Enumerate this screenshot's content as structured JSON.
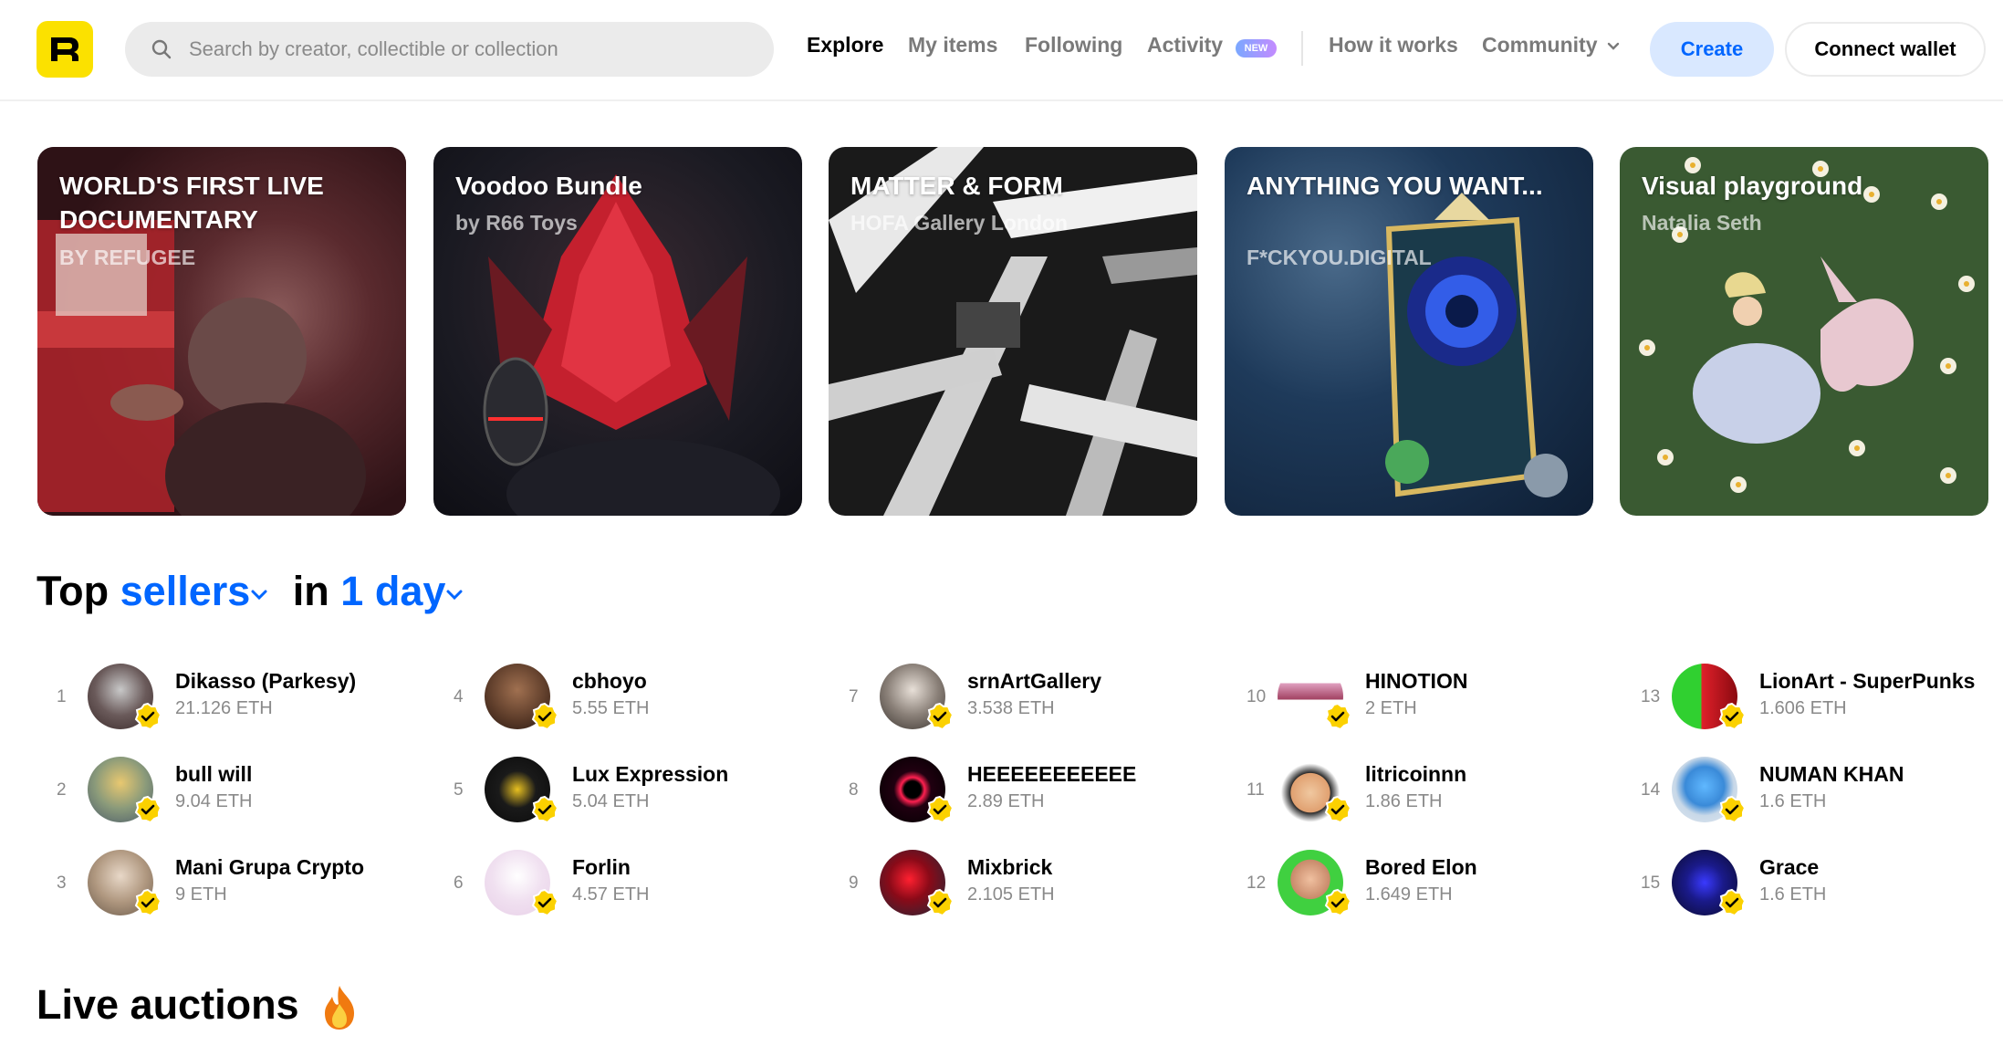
{
  "header": {
    "search_placeholder": "Search by creator, collectible or collection",
    "nav": {
      "explore": "Explore",
      "my_items": "My items",
      "following": "Following",
      "activity": "Activity",
      "activity_badge": "NEW",
      "how_it_works": "How it works",
      "community": "Community"
    },
    "create_label": "Create",
    "connect_label": "Connect wallet"
  },
  "banners": [
    {
      "title": "WORLD'S FIRST LIVE DOCUMENTARY",
      "subtitle": "BY REFUGEE"
    },
    {
      "title": "Voodoo Bundle",
      "subtitle": "by R66 Toys"
    },
    {
      "title": "MATTER & FORM",
      "subtitle": "HOFA Gallery London"
    },
    {
      "title": "ANYTHING YOU WANT...",
      "subtitle": "F*CKYOU.DIGITAL"
    },
    {
      "title": "Visual playground",
      "subtitle": "Natalia Seth"
    }
  ],
  "top_sellers": {
    "prefix": "Top",
    "kind": "sellers",
    "connector": "in",
    "period": "1 day",
    "items": [
      {
        "rank": "1",
        "name": "Dikasso (Parkesy)",
        "eth": "21.126 ETH"
      },
      {
        "rank": "2",
        "name": "bull will",
        "eth": "9.04 ETH"
      },
      {
        "rank": "3",
        "name": "Mani Grupa Crypto",
        "eth": "9 ETH"
      },
      {
        "rank": "4",
        "name": "cbhoyo",
        "eth": "5.55 ETH"
      },
      {
        "rank": "5",
        "name": "Lux Expression",
        "eth": "5.04 ETH"
      },
      {
        "rank": "6",
        "name": "Forlin",
        "eth": "4.57 ETH"
      },
      {
        "rank": "7",
        "name": "srnArtGallery",
        "eth": "3.538 ETH"
      },
      {
        "rank": "8",
        "name": "HEEEEEEEEEEE",
        "eth": "2.89 ETH"
      },
      {
        "rank": "9",
        "name": "Mixbrick",
        "eth": "2.105 ETH"
      },
      {
        "rank": "10",
        "name": "HINOTION",
        "eth": "2 ETH"
      },
      {
        "rank": "11",
        "name": "litricoinnn",
        "eth": "1.86 ETH"
      },
      {
        "rank": "12",
        "name": "Bored Elon",
        "eth": "1.649 ETH"
      },
      {
        "rank": "13",
        "name": "LionArt - SuperPunks",
        "eth": "1.606 ETH"
      },
      {
        "rank": "14",
        "name": "NUMAN KHAN",
        "eth": "1.6 ETH"
      },
      {
        "rank": "15",
        "name": "Grace",
        "eth": "1.6 ETH"
      }
    ]
  },
  "live_auctions": {
    "title": "Live auctions"
  },
  "colors": {
    "accent": "#0066ff",
    "brand_yellow": "#fbe100",
    "muted": "#8a8a8a"
  }
}
